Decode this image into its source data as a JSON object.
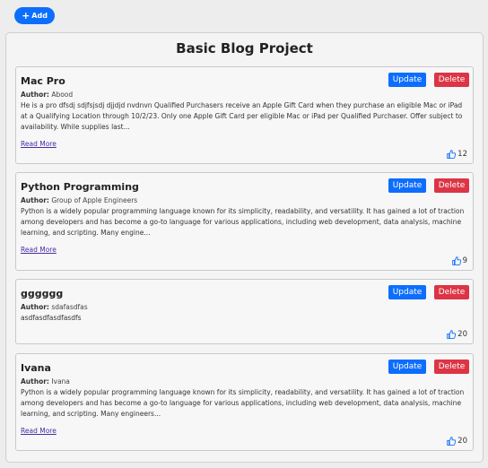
{
  "toolbar": {
    "add_label": "Add"
  },
  "page": {
    "title": "Basic Blog Project"
  },
  "posts": [
    {
      "title": "Mac Pro",
      "author_label": "Author:",
      "author": "Abood",
      "body": "He is a pro dfsdj sdjfsjsdj djjdjd nvdnvn Qualified Purchasers receive an Apple Gift Card when they purchase an eligible Mac or iPad at a Qualifying Location through 10/2/23. Only one Apple Gift Card per eligible Mac or iPad per Qualified Purchaser. Offer subject to availability. While supplies last...",
      "read_more": "Read More",
      "update_label": "Update",
      "delete_label": "Delete",
      "likes": "12"
    },
    {
      "title": "Python Programming",
      "author_label": "Author:",
      "author": "Group of Apple Engineers",
      "body": "Python is a widely popular programming language known for its simplicity, readability, and versatility. It has gained a lot of traction among developers and has become a go-to language for various applications, including web development, data analysis, machine learning, and scripting. Many engine...",
      "read_more": "Read More",
      "update_label": "Update",
      "delete_label": "Delete",
      "likes": "9"
    },
    {
      "title": "gggggg",
      "author_label": "Author:",
      "author": "sdafasdfas",
      "body": "asdfasdfasdfasdfs",
      "update_label": "Update",
      "delete_label": "Delete",
      "likes": "20"
    },
    {
      "title": "Ivana",
      "author_label": "Author:",
      "author": "Ivana",
      "body": "Python is a widely popular programming language known for its simplicity, readability, and versatility. It has gained a lot of traction among developers and has become a go-to language for various applications, including web development, data analysis, machine learning, and scripting. Many engineers...",
      "read_more": "Read More",
      "update_label": "Update",
      "delete_label": "Delete",
      "likes": "20"
    }
  ],
  "icons": {
    "add": "plus-icon",
    "like": "thumbs-up-icon"
  },
  "colors": {
    "primary": "#0d6efd",
    "danger": "#dc3545",
    "link": "#4a2ca5"
  }
}
